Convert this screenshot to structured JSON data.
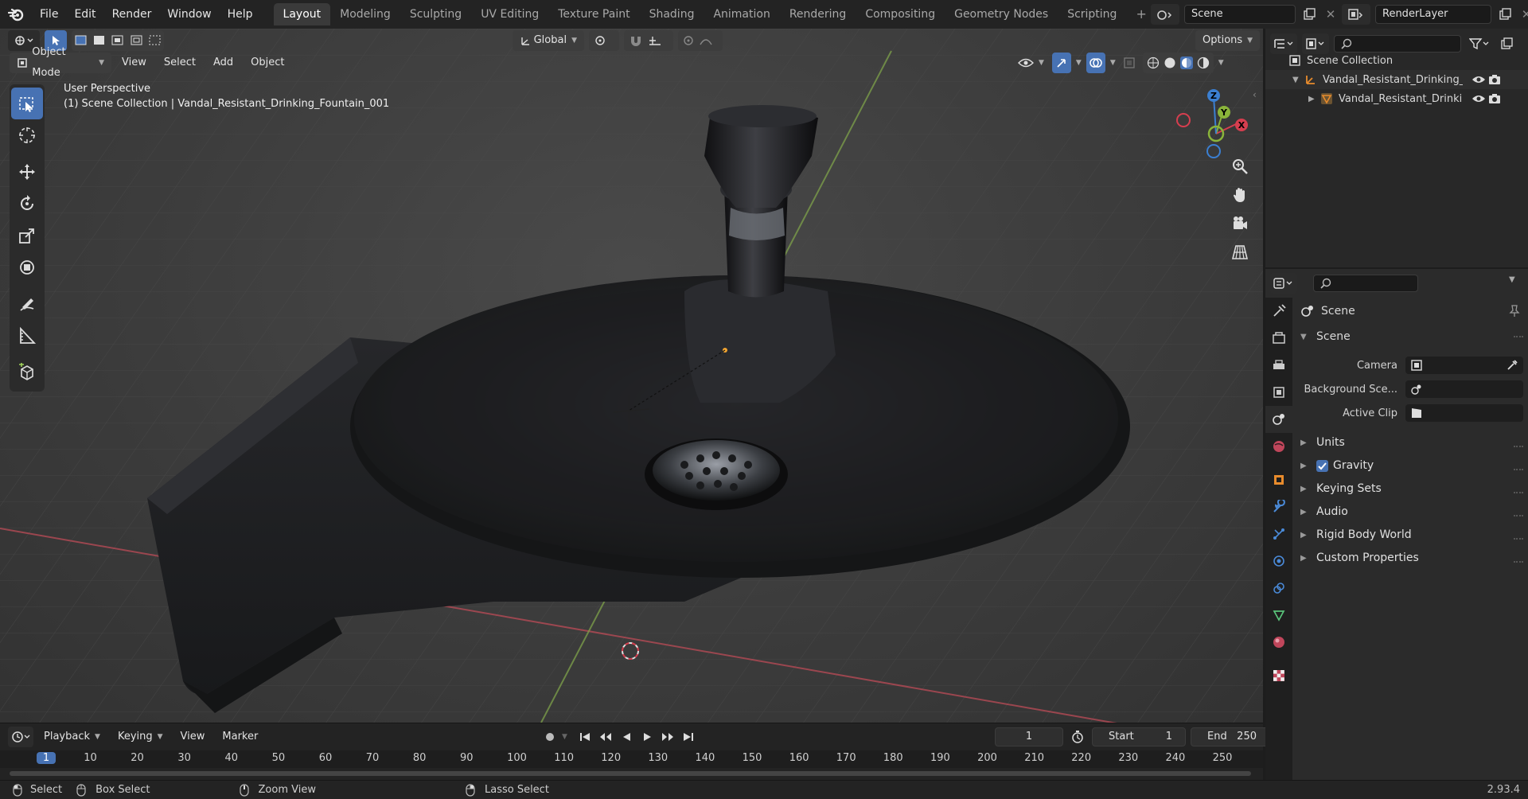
{
  "menu": [
    "File",
    "Edit",
    "Render",
    "Window",
    "Help"
  ],
  "workspaces": [
    {
      "label": "Layout",
      "active": true
    },
    {
      "label": "Modeling"
    },
    {
      "label": "Sculpting"
    },
    {
      "label": "UV Editing"
    },
    {
      "label": "Texture Paint"
    },
    {
      "label": "Shading"
    },
    {
      "label": "Animation"
    },
    {
      "label": "Rendering"
    },
    {
      "label": "Compositing"
    },
    {
      "label": "Geometry Nodes"
    },
    {
      "label": "Scripting"
    }
  ],
  "scene_name": "Scene",
  "render_layer": "RenderLayer",
  "viewport": {
    "transform_orientation": "Global",
    "options_label": "Options",
    "mode": "Object Mode",
    "header_menus": [
      "View",
      "Select",
      "Add",
      "Object"
    ],
    "overlay_title": "User Perspective",
    "overlay_subtitle": "(1) Scene Collection | Vandal_Resistant_Drinking_Fountain_001",
    "gizmo_axes": {
      "x": "X",
      "y": "Y",
      "z": "Z"
    }
  },
  "outliner": {
    "root": "Scene Collection",
    "items": [
      {
        "label": "Vandal_Resistant_Drinking_F"
      },
      {
        "label": "Vandal_Resistant_Drinkir"
      }
    ]
  },
  "properties": {
    "context_label": "Scene",
    "panel_title": "Scene",
    "fields": [
      {
        "label": "Camera"
      },
      {
        "label": "Background Sce..."
      },
      {
        "label": "Active Clip"
      }
    ],
    "sections": [
      "Units",
      "Gravity",
      "Keying Sets",
      "Audio",
      "Rigid Body World",
      "Custom Properties"
    ],
    "gravity_checked": true
  },
  "timeline": {
    "menus": [
      "Playback",
      "Keying",
      "View",
      "Marker"
    ],
    "current_frame": "1",
    "start_label": "Start",
    "start_value": "1",
    "end_label": "End",
    "end_value": "250",
    "ticks": [
      "1",
      "10",
      "20",
      "30",
      "40",
      "50",
      "60",
      "70",
      "80",
      "90",
      "100",
      "110",
      "120",
      "130",
      "140",
      "150",
      "160",
      "170",
      "180",
      "190",
      "200",
      "210",
      "220",
      "230",
      "240",
      "250"
    ]
  },
  "statusbar": {
    "items": [
      "Select",
      "Box Select",
      "Zoom View",
      "Lasso Select"
    ],
    "version": "2.93.4"
  },
  "colors": {
    "accent": "#4772b3",
    "x_axis": "#d63e4f",
    "y_axis": "#8ab43a",
    "z_axis": "#3b7fd1"
  }
}
